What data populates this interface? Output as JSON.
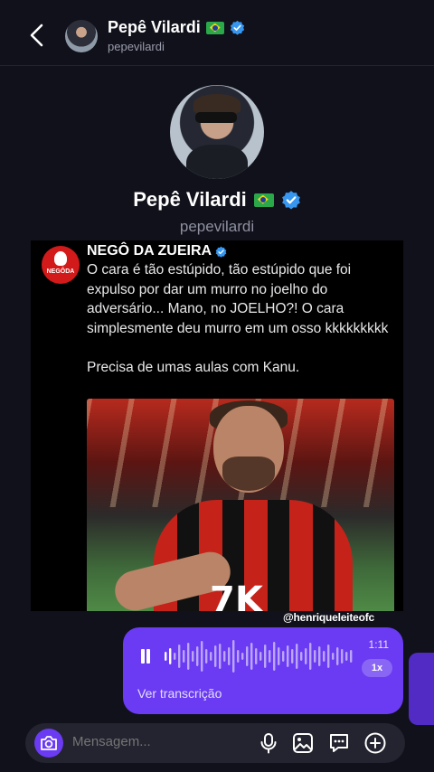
{
  "header": {
    "name": "Pepê Vilardi",
    "username": "pepevilardi"
  },
  "profile": {
    "name": "Pepê Vilardi",
    "username": "pepevilardi"
  },
  "shared_post": {
    "author": "NEGÔ DA ZUEIRA",
    "logo_text": "NEGÔDA",
    "text": "O cara é tão estúpido, tão estúpido que foi expulso por dar um murro no joelho do adversário...  Mano, no JOELHO?! O cara simplesmente deu murro em um osso kkkkkkkkk\n\nPrecisa de umas aulas com Kanu.",
    "watermark": "@henriqueleiteofc"
  },
  "voice_message": {
    "duration": "1:11",
    "speed": "1x",
    "transcript_link": "Ver transcrição"
  },
  "composer": {
    "placeholder": "Mensagem..."
  },
  "colors": {
    "accent": "#6a3bf2",
    "verified": "#3797f0",
    "background": "#10111a"
  },
  "icons": [
    "back-arrow-icon",
    "verified-icon",
    "brazil-flag-icon",
    "pause-icon",
    "camera-icon",
    "microphone-icon",
    "gallery-icon",
    "sticker-icon",
    "plus-icon"
  ]
}
